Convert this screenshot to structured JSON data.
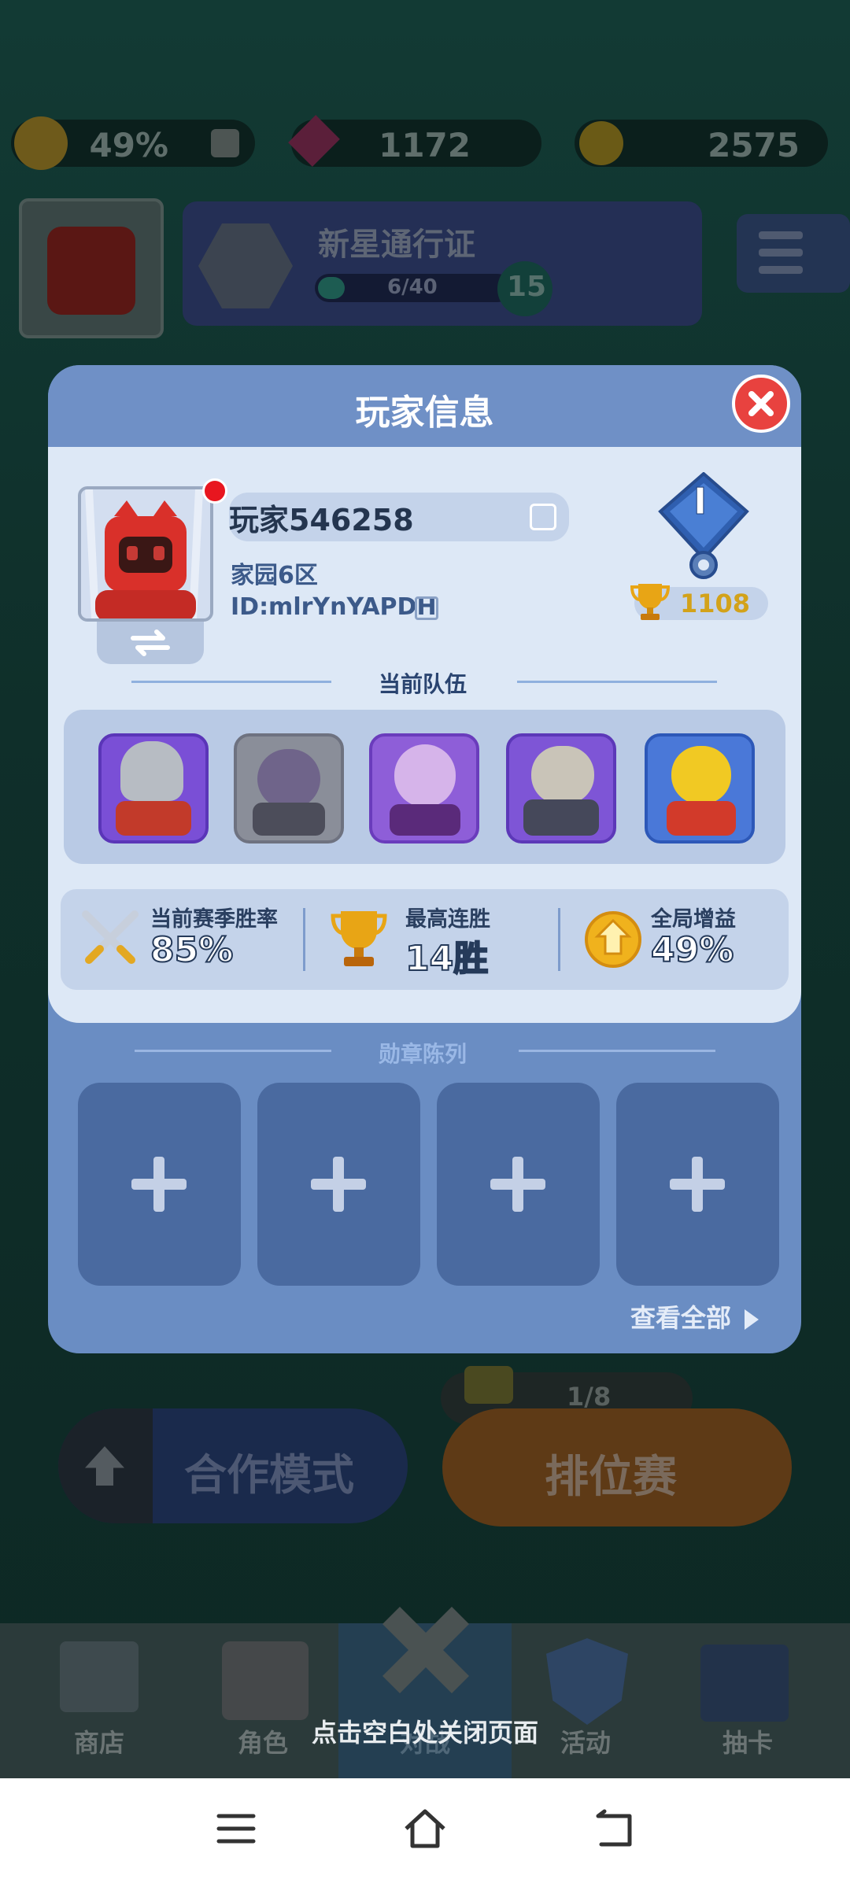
{
  "background": {
    "resources": [
      {
        "name": "boost",
        "value": "49%"
      },
      {
        "name": "gem",
        "value": "1172"
      },
      {
        "name": "coin",
        "value": "2575"
      }
    ],
    "pass": {
      "title": "新星通行证",
      "progress": "6/40",
      "level": "15"
    },
    "mode_buttons": {
      "coop": "合作模式",
      "ranked": "排位赛",
      "ranked_count": "1/8"
    },
    "tabs": [
      "商店",
      "角色",
      "对战",
      "活动",
      "抽卡"
    ]
  },
  "modal": {
    "title": "玩家信息",
    "player": {
      "name": "玩家546258",
      "server": "家园6区",
      "id": "ID:mlrYnYAPDH",
      "rank_numeral": "I",
      "trophies": "1108"
    },
    "team_label": "当前队伍",
    "heroes": [
      "knight-hero",
      "ghost-hero",
      "witch-hero",
      "armored-hero",
      "spartan-hero"
    ],
    "stats": [
      {
        "label": "当前赛季胜率",
        "value": "85%"
      },
      {
        "label": "最高连胜",
        "value": "14胜"
      },
      {
        "label": "全局增益",
        "value": "49%"
      }
    ],
    "badges_label": "勋章陈列",
    "badge_slot_symbol": "+",
    "view_all": "查看全部"
  },
  "hint": "点击空白处关闭页面",
  "colors": {
    "modal": "#6a8dc3",
    "card": "#dde8f6",
    "close": "#e8423f",
    "trophy": "#d3a21a"
  }
}
